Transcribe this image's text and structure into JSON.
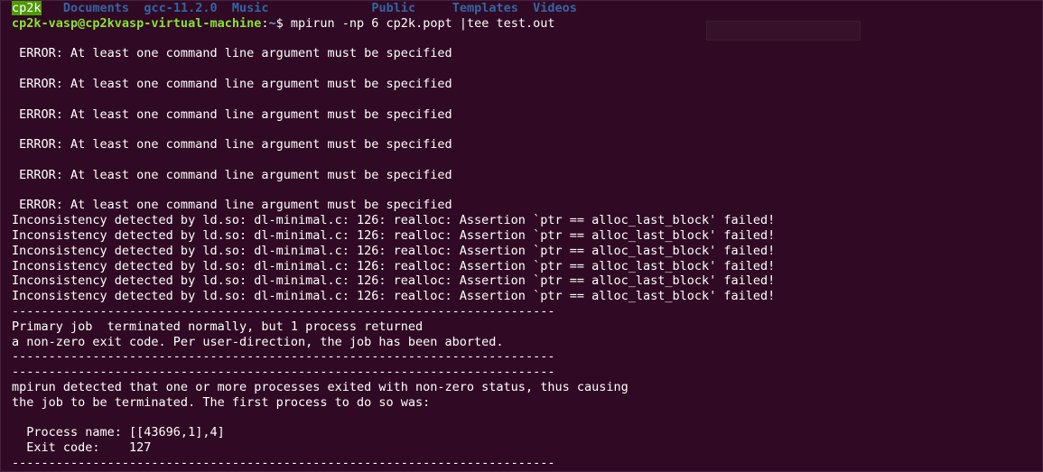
{
  "ls": {
    "items": [
      "cp2k",
      "Documents",
      "gcc-11.2.0",
      "Music",
      "Public",
      "Templates",
      "Videos"
    ]
  },
  "prompt": {
    "user_host": "cp2k-vasp@cp2kvasp-virtual-machine",
    "separator": ":",
    "path": "~",
    "symbol": "$",
    "command": " mpirun -np 6 cp2k.popt |tee test.out"
  },
  "errors": {
    "message": " ERROR: At least one command line argument must be specified"
  },
  "inconsistency": {
    "message": "Inconsistency detected by ld.so: dl-minimal.c: 126: realloc: Assertion `ptr == alloc_last_block' failed!"
  },
  "separator_line": "--------------------------------------------------------------------------",
  "primary_job": {
    "line1": "Primary job  terminated normally, but 1 process returned",
    "line2": "a non-zero exit code. Per user-direction, the job has been aborted."
  },
  "mpirun_msg": {
    "line1": "mpirun detected that one or more processes exited with non-zero status, thus causing",
    "line2": "the job to be terminated. The first process to do so was:"
  },
  "process": {
    "name_line": "  Process name: [[43696,1],4]",
    "exit_line": "  Exit code:    127"
  },
  "colors": {
    "background": "#300a24",
    "text": "#ffffff",
    "directory": "#3465a4",
    "prompt_user": "#8ae234",
    "prompt_path": "#729fcf",
    "highlight": "#4e9a06"
  }
}
